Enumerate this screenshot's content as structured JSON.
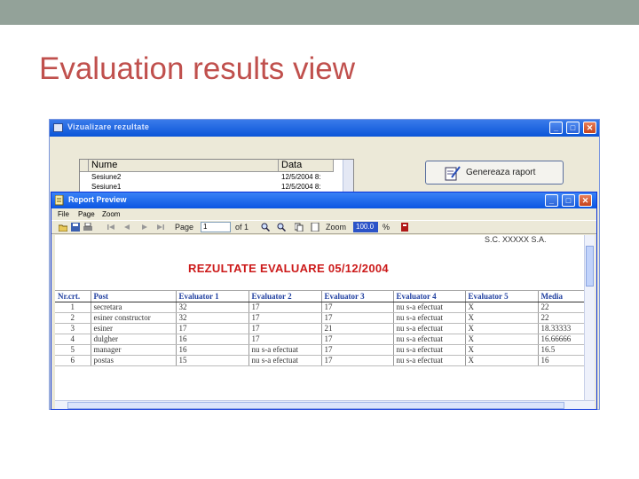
{
  "slide": {
    "title": "Evaluation results view"
  },
  "main_window": {
    "title": "Vizualizare rezultate",
    "grid": {
      "columns": [
        "Nume",
        "Data"
      ],
      "rows": [
        {
          "name": "Sesiune2",
          "date": "12/5/2004 8:"
        },
        {
          "name": "Sesiune1",
          "date": "12/5/2004 8:"
        }
      ]
    },
    "generate_button": "Genereaza raport"
  },
  "report_window": {
    "title": "Report Preview",
    "menu": [
      "File",
      "Page",
      "Zoom"
    ],
    "toolbar": {
      "page_label": "Page",
      "page_value": "1",
      "of_label": "of 1",
      "zoom_label": "Zoom",
      "zoom_value": "100.0",
      "percent": "%"
    },
    "report": {
      "company": "S.C. XXXXX S.A.",
      "heading": "REZULTATE EVALUARE 05/12/2004",
      "columns": [
        "Nr.crt.",
        "Post",
        "Evaluator 1",
        "Evaluator 2",
        "Evaluator 3",
        "Evaluator 4",
        "Evaluator 5",
        "Media"
      ],
      "rows": [
        [
          "1",
          "secretara",
          "32",
          "17",
          "17",
          "nu s-a efectuat",
          "X",
          "22"
        ],
        [
          "2",
          "esiner constructor",
          "32",
          "17",
          "17",
          "nu s-a efectuat",
          "X",
          "22"
        ],
        [
          "3",
          "esiner",
          "17",
          "17",
          "21",
          "nu s-a efectuat",
          "X",
          "18.33333"
        ],
        [
          "4",
          "dulgher",
          "16",
          "17",
          "17",
          "nu s-a efectuat",
          "X",
          "16.66666"
        ],
        [
          "5",
          "manager",
          "16",
          "nu s-a efectuat",
          "17",
          "nu s-a efectuat",
          "X",
          "16.5"
        ],
        [
          "6",
          "postas",
          "15",
          "nu s-a efectuat",
          "17",
          "nu s-a efectuat",
          "X",
          "16"
        ]
      ]
    }
  },
  "colors": {
    "title_accent": "#c0504d",
    "topbar": "#93a299",
    "report_heading": "#cc1a1a",
    "table_header": "#1f3fa0"
  }
}
